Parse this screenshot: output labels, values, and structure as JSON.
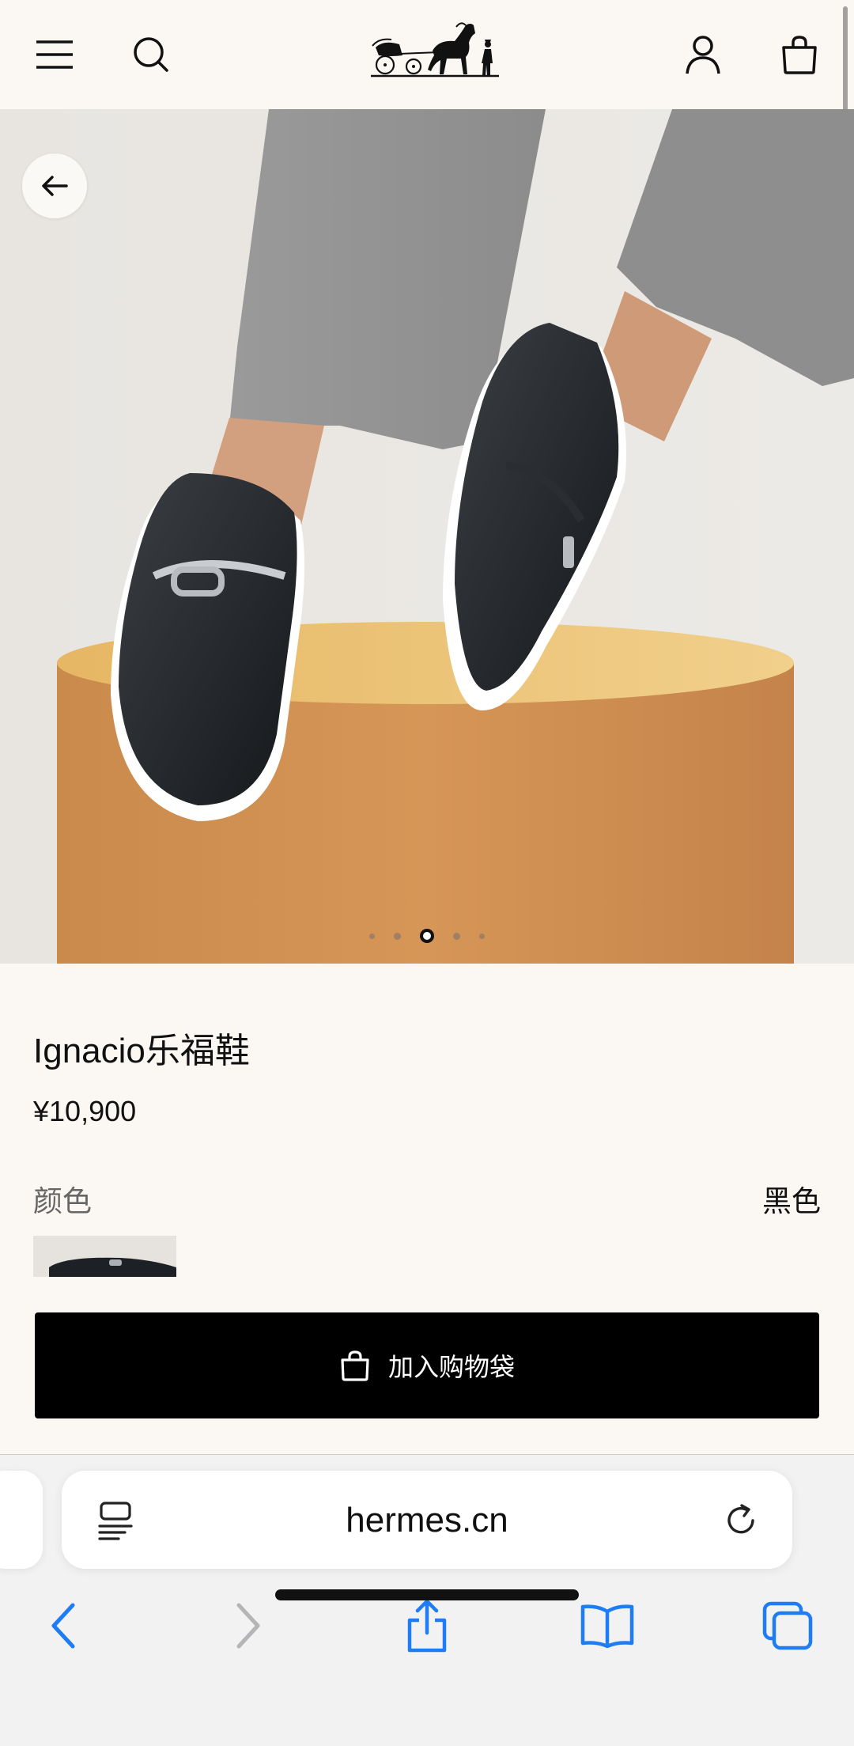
{
  "header": {
    "menu_icon": "menu-icon",
    "search_icon": "search-icon",
    "logo": "hermes-carriage-logo",
    "account_icon": "account-icon",
    "bag_icon": "shopping-bag-icon"
  },
  "gallery": {
    "image_alt": "product-photo",
    "back_icon": "arrow-left-icon",
    "dot_count": 5,
    "active_index": 2
  },
  "product": {
    "name": "Ignacio乐福鞋",
    "price": "¥10,900",
    "color_label": "颜色",
    "color_value": "黑色",
    "add_to_bag": "加入购物袋"
  },
  "browser": {
    "url": "hermes.cn",
    "reader_icon": "reader-mode-icon",
    "reload_icon": "reload-icon",
    "toolbar": [
      "back-icon",
      "forward-icon",
      "share-icon",
      "bookmarks-icon",
      "tabs-icon"
    ]
  },
  "colors": {
    "header_bg": "#fbf8f4",
    "button_bg": "#000000",
    "safari_blue": "#1e7cf5"
  }
}
